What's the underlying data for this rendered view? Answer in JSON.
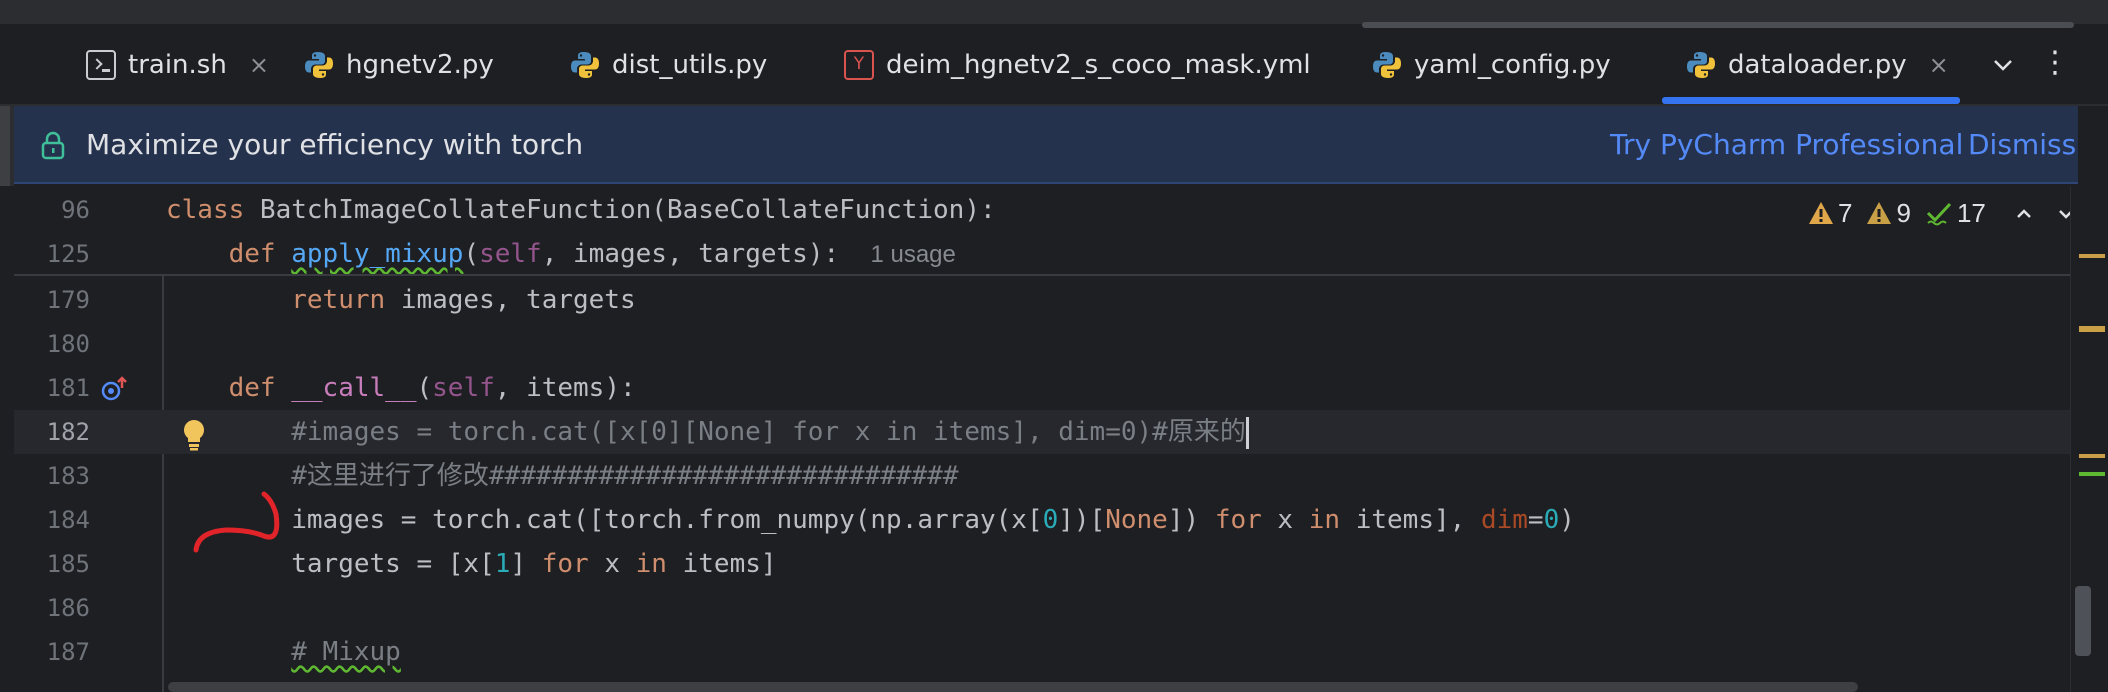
{
  "tabs": [
    {
      "label": "train.sh",
      "icon": "terminal-icon",
      "close": "×"
    },
    {
      "label": "hgnetv2.py",
      "icon": "python-icon"
    },
    {
      "label": "dist_utils.py",
      "icon": "python-icon"
    },
    {
      "label": "deim_hgnetv2_s_coco_mask.yml",
      "icon": "yaml-icon",
      "icon_letter": "Y"
    },
    {
      "label": "yaml_config.py",
      "icon": "python-icon"
    },
    {
      "label": "dataloader.py",
      "icon": "python-icon",
      "close": "×",
      "active": true
    }
  ],
  "tab_more_glyph": "⋮",
  "banner": {
    "message": "Maximize your efficiency with torch",
    "try_label": "Try PyCharm Professional",
    "dismiss_label": "Dismiss"
  },
  "inspections": {
    "errors": "7",
    "warnings": "9",
    "ok": "17"
  },
  "sticky_lines": [
    {
      "num": "96",
      "kw": "class ",
      "name": "BatchImageCollateFunction",
      "rest": "(BaseCollateFunction):"
    },
    {
      "num": "125",
      "indent": "    ",
      "kw": "def ",
      "name": "apply_mixup",
      "open": "(",
      "self": "self",
      "rest": ", images, targets):",
      "hint": "1 usage"
    }
  ],
  "lines": [
    {
      "num": "179",
      "indent": "        ",
      "kw": "return ",
      "rest": "images, targets"
    },
    {
      "num": "180"
    },
    {
      "num": "181",
      "indent": "    ",
      "kw": "def ",
      "name": "__call__",
      "open": "(",
      "self": "self",
      "rest": ", items):"
    },
    {
      "num": "182",
      "indent": "        ",
      "comment": "#images = torch.cat([x[0][None] for x in items], dim=0)#原来的"
    },
    {
      "num": "183",
      "indent": "        ",
      "comment": "#这里进行了修改##############################"
    },
    {
      "num": "184",
      "indent": "        ",
      "p1": "images = torch.cat([torch.from_numpy(np.array(x[",
      "n1": "0",
      "p2": "])[",
      "none": "None",
      "p3": "]) ",
      "for": "for",
      "p4": " x ",
      "in": "in",
      "p5": " items], ",
      "param": "dim",
      "p6": "=",
      "n2": "0",
      "p7": ")"
    },
    {
      "num": "185",
      "indent": "        ",
      "p1": "targets = [x[",
      "n1": "1",
      "p2": "] ",
      "for": "for",
      "p3": " x ",
      "in": "in",
      "p4": " items]"
    },
    {
      "num": "186"
    },
    {
      "num": "187",
      "indent": "        ",
      "comment": "# Mixup"
    }
  ],
  "colors": {
    "accent": "#3574f0",
    "banner_link": "#548af7",
    "keyword": "#cf8e6d",
    "function": "#56a8f5",
    "comment": "#7a7e85",
    "number": "#2aacb8",
    "warning": "#e0a64a",
    "ok": "#5fb832",
    "annotation": "#e0242a"
  }
}
